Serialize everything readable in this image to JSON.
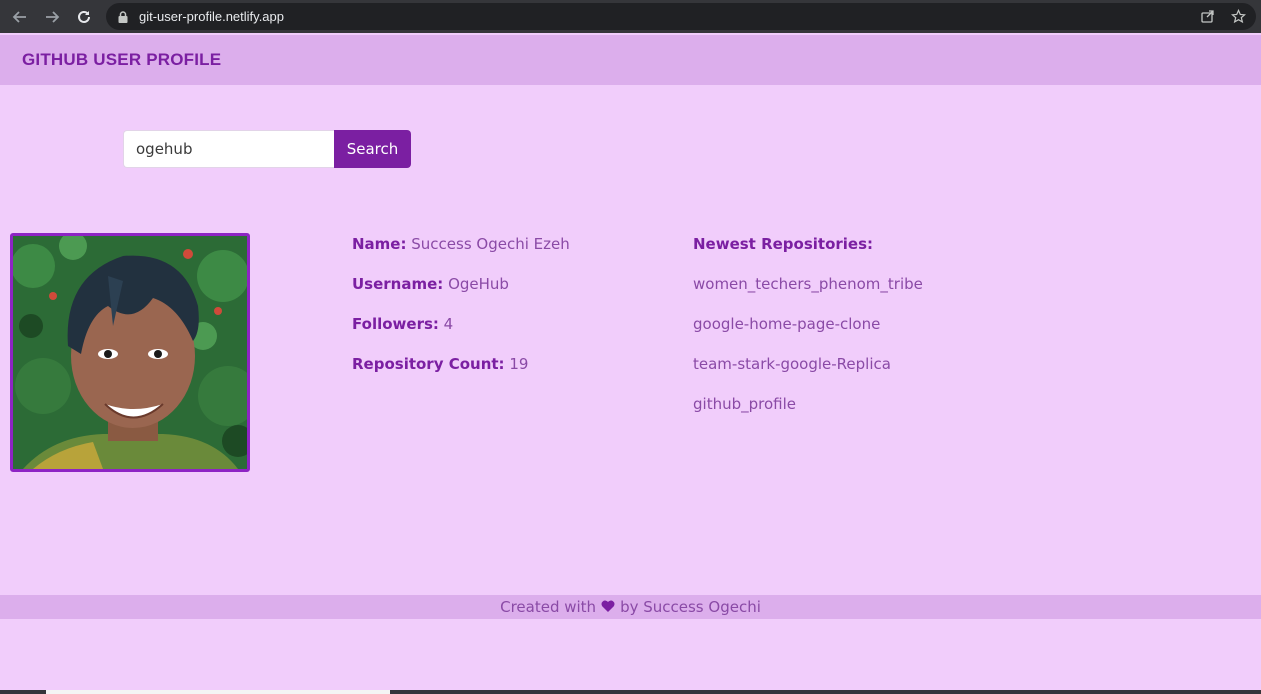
{
  "browser": {
    "url": "git-user-profile.netlify.app",
    "icons": [
      "back-arrow-icon",
      "forward-arrow-icon",
      "reload-icon",
      "lock-icon",
      "share-icon",
      "star-icon"
    ]
  },
  "header": {
    "title": "GITHUB USER PROFILE"
  },
  "search": {
    "value": "ogehub",
    "button_label": "Search"
  },
  "profile": {
    "name_label": "Name:",
    "name": "Success Ogechi Ezeh",
    "username_label": "Username:",
    "username": "OgeHub",
    "followers_label": "Followers:",
    "followers": "4",
    "repo_count_label": "Repository Count:",
    "repo_count": "19"
  },
  "repos": {
    "heading": "Newest Repositories:",
    "items": [
      "women_techers_phenom_tribe",
      "google-home-page-clone",
      "team-stark-google-Replica",
      "github_profile"
    ]
  },
  "footer": {
    "prefix": "Created with",
    "suffix": "by Success Ogechi"
  },
  "colors": {
    "page_bg": "#f1cdfb",
    "header_bg": "#dcaeec",
    "accent": "#7b1fa2",
    "text": "#8a4aa6"
  }
}
